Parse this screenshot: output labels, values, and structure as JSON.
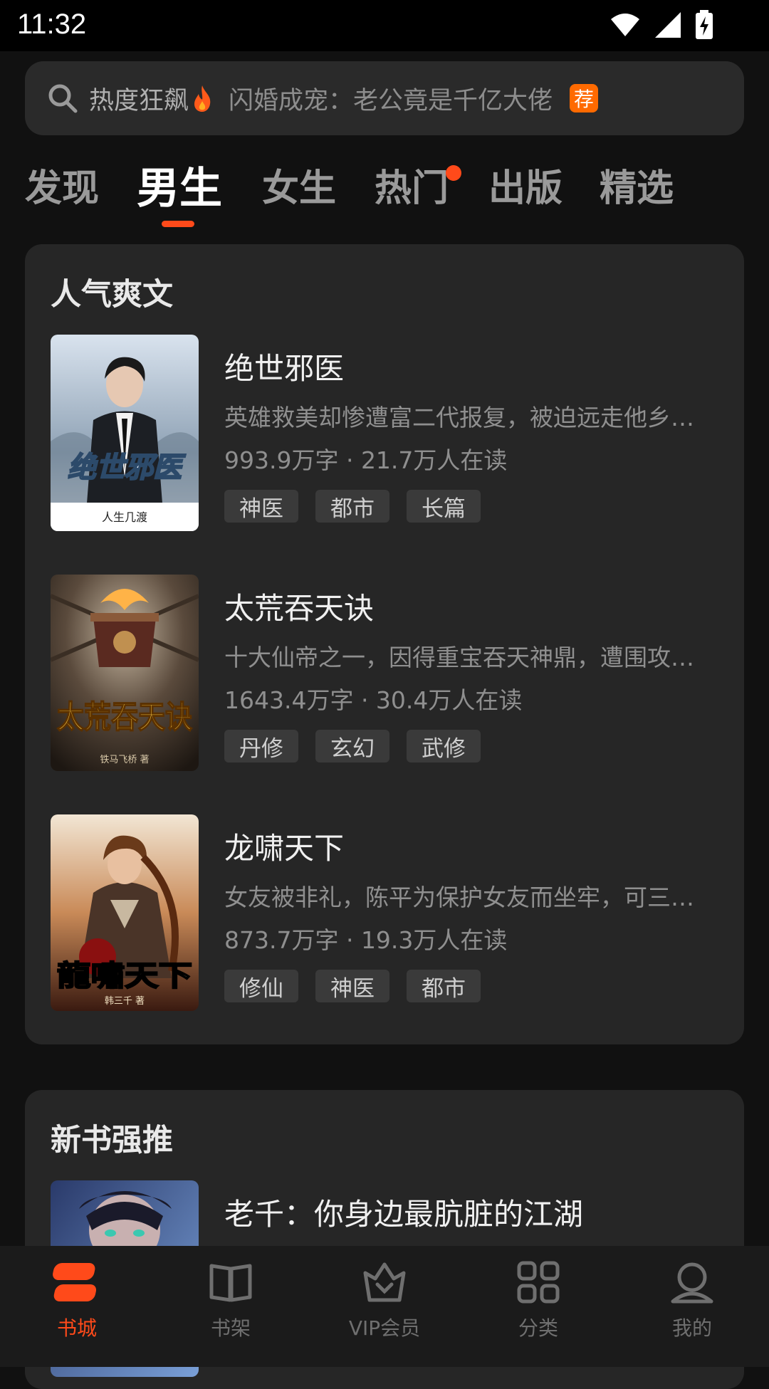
{
  "status_bar": {
    "time": "11:32"
  },
  "search": {
    "hot_label": "热度狂飙",
    "placeholder": "闪婚成宠：老公竟是千亿大佬",
    "badge": "荐"
  },
  "tabs": [
    {
      "label": "发现"
    },
    {
      "label": "男生",
      "active": true
    },
    {
      "label": "女生"
    },
    {
      "label": "热门",
      "dot": true
    },
    {
      "label": "出版"
    },
    {
      "label": "精选"
    }
  ],
  "section1": {
    "title": "人气爽文",
    "books": [
      {
        "title": "绝世邪医",
        "desc": "英雄救美却惨遭富二代报复，被迫远走他乡…",
        "meta": "993.9万字 · 21.7万人在读",
        "tags": [
          "神医",
          "都市",
          "长篇"
        ],
        "cover_title": "绝世邪医",
        "cover_author": "人生几渡"
      },
      {
        "title": "太荒吞天诀",
        "desc": "十大仙帝之一，因得重宝吞天神鼎，遭围攻…",
        "meta": "1643.4万字 · 30.4万人在读",
        "tags": [
          "丹修",
          "玄幻",
          "武修"
        ],
        "cover_title": "太荒吞天诀",
        "cover_author": "铁马飞桥 著"
      },
      {
        "title": "龙啸天下",
        "desc": "女友被非礼，陈平为保护女友而坐牢，可三…",
        "meta": "873.7万字 · 19.3万人在读",
        "tags": [
          "修仙",
          "神医",
          "都市"
        ],
        "cover_title": "龍嘯天下",
        "cover_author": "韩三千 著"
      }
    ]
  },
  "section2": {
    "title": "新书强推",
    "books": [
      {
        "title": "老千：你身边最肮脏的江湖"
      }
    ]
  },
  "bottom_nav": [
    {
      "label": "书城",
      "icon": "bookstore-icon",
      "active": true
    },
    {
      "label": "书架",
      "icon": "bookshelf-icon"
    },
    {
      "label": "VIP会员",
      "icon": "vip-crown-icon"
    },
    {
      "label": "分类",
      "icon": "category-grid-icon"
    },
    {
      "label": "我的",
      "icon": "profile-icon"
    }
  ],
  "colors": {
    "accent": "#ff4a1a",
    "badge": "#ff6a00",
    "background": "#111111",
    "card": "#262626"
  }
}
